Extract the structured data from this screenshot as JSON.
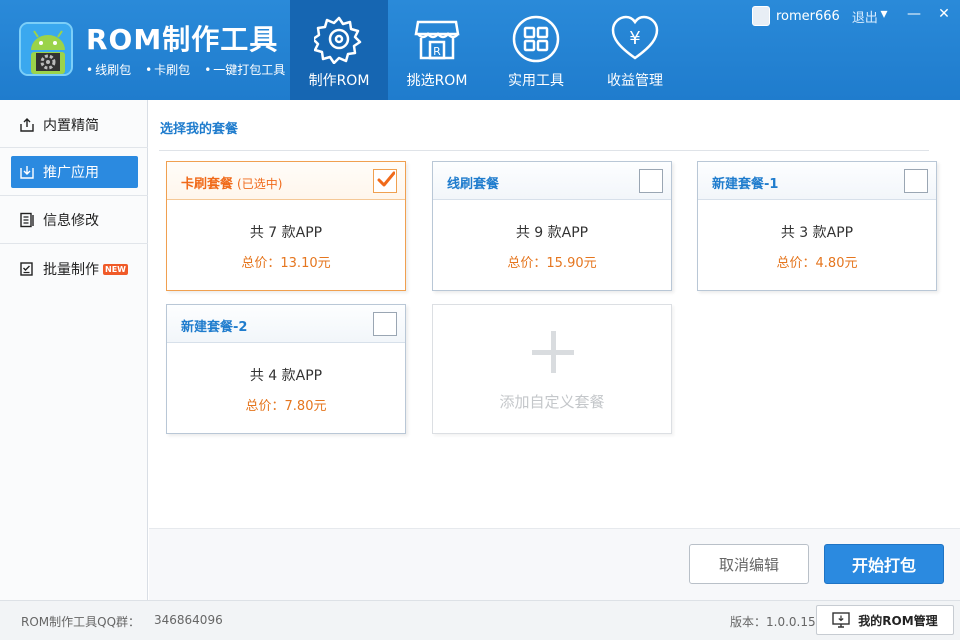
{
  "header": {
    "app_title": "ROM制作工具",
    "subtitle_items": [
      "线刷包",
      "卡刷包",
      "一键打包工具"
    ],
    "tabs": [
      {
        "label": "制作ROM",
        "icon": "gear-icon"
      },
      {
        "label": "挑选ROM",
        "icon": "shop-icon"
      },
      {
        "label": "实用工具",
        "icon": "grid-icon"
      },
      {
        "label": "收益管理",
        "icon": "heart-yen-icon"
      }
    ],
    "username": "romer666",
    "logout_label": "退出",
    "min_glyph": "▾",
    "minimize_glyph": "—",
    "close_glyph": "✕"
  },
  "sidebar": {
    "items": [
      {
        "label": "内置精简"
      },
      {
        "label": "推广应用"
      },
      {
        "label": "信息修改"
      },
      {
        "label": "批量制作",
        "badge": "NEW"
      }
    ]
  },
  "main": {
    "section_title": "选择我的套餐",
    "packages": [
      {
        "name": "卡刷套餐",
        "status": "(已选中)",
        "count": "共 7 款APP",
        "price": "总价：13.10元",
        "checked": true
      },
      {
        "name": "线刷套餐",
        "status": "",
        "count": "共 9 款APP",
        "price": "总价：15.90元",
        "checked": false
      },
      {
        "name": "新建套餐-1",
        "status": "",
        "count": "共 3 款APP",
        "price": "总价：4.80元",
        "checked": false
      },
      {
        "name": "新建套餐-2",
        "status": "",
        "count": "共 4 款APP",
        "price": "总价：7.80元",
        "checked": false
      }
    ],
    "add_label": "添加自定义套餐",
    "cancel_label": "取消编辑",
    "start_label": "开始打包"
  },
  "footer": {
    "qq_label": "ROM制作工具QQ群：",
    "qq_number": "346864096",
    "version": "版本：1.0.0.15",
    "my_rom_label": "我的ROM管理"
  },
  "colors": {
    "header_blue": "#1f7ccd",
    "active_tab": "#1666b2",
    "accent_orange": "#e5761f",
    "primary_button": "#2b8ae0"
  }
}
